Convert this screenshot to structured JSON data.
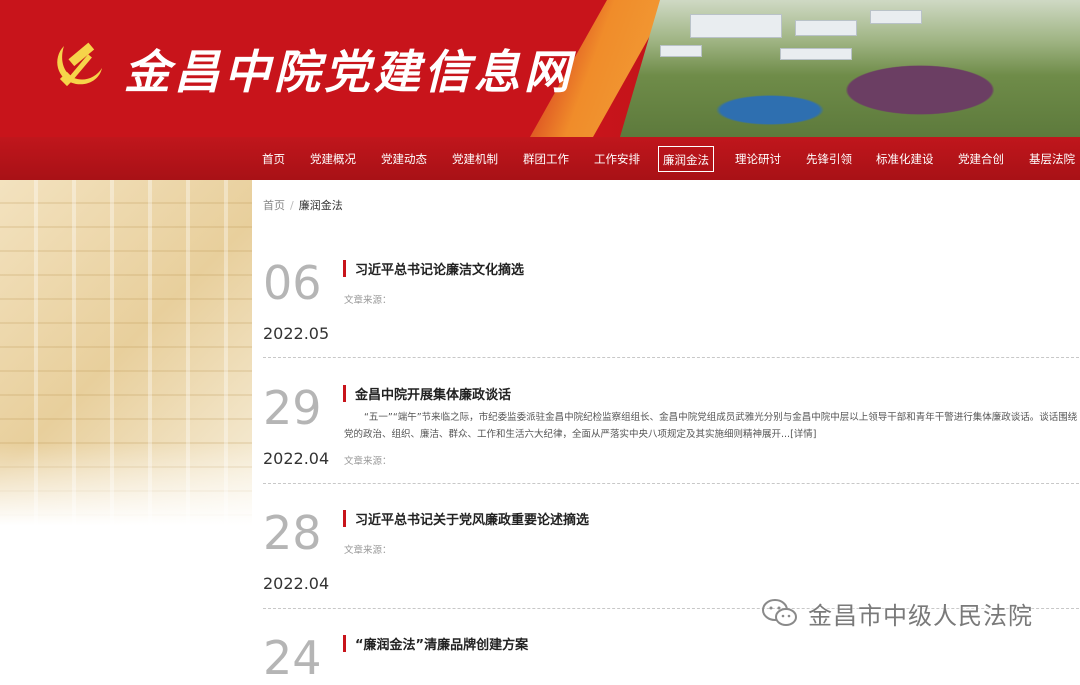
{
  "header": {
    "site_title": "金昌中院党建信息网"
  },
  "nav": {
    "items": [
      {
        "label": "首页",
        "active": false
      },
      {
        "label": "党建概况",
        "active": false
      },
      {
        "label": "党建动态",
        "active": false
      },
      {
        "label": "党建机制",
        "active": false
      },
      {
        "label": "群团工作",
        "active": false
      },
      {
        "label": "工作安排",
        "active": false
      },
      {
        "label": "廉润金法",
        "active": true
      },
      {
        "label": "理论研讨",
        "active": false
      },
      {
        "label": "先锋引领",
        "active": false
      },
      {
        "label": "标准化建设",
        "active": false
      },
      {
        "label": "党建合创",
        "active": false
      },
      {
        "label": "基层法院",
        "active": false
      }
    ]
  },
  "breadcrumb": {
    "home": "首页",
    "separator": "/",
    "current": "廉润金法"
  },
  "articles": [
    {
      "day": "06",
      "year_month": "2022.05",
      "title": "习近平总书记论廉洁文化摘选",
      "source": "文章来源：",
      "summary": "",
      "more": ""
    },
    {
      "day": "29",
      "year_month": "2022.04",
      "title": "金昌中院开展集体廉政谈话",
      "source": "文章来源：",
      "summary": "“五一”“端午”节来临之际，市纪委监委派驻金昌中院纪检监察组组长、金昌中院党组成员武雅光分别与金昌中院中层以上领导干部和青年干警进行集体廉政谈话。谈话围绕党的政治、组织、廉洁、群众、工作和生活六大纪律，全面从严落实中央八项规定及其实施细则精神展开...",
      "more": "[详情]"
    },
    {
      "day": "28",
      "year_month": "2022.04",
      "title": "习近平总书记关于党风廉政重要论述摘选",
      "source": "文章来源：",
      "summary": "",
      "more": ""
    },
    {
      "day": "24",
      "year_month": "",
      "title": "“廉润金法”清廉品牌创建方案",
      "source": "",
      "summary": "",
      "more": ""
    }
  ],
  "watermark": {
    "text": "金昌市中级人民法院",
    "icon": "wechat-icon"
  },
  "colors": {
    "brand_red": "#c8141b",
    "nav_red": "#b01318",
    "date_gray": "#b5b5b5"
  }
}
